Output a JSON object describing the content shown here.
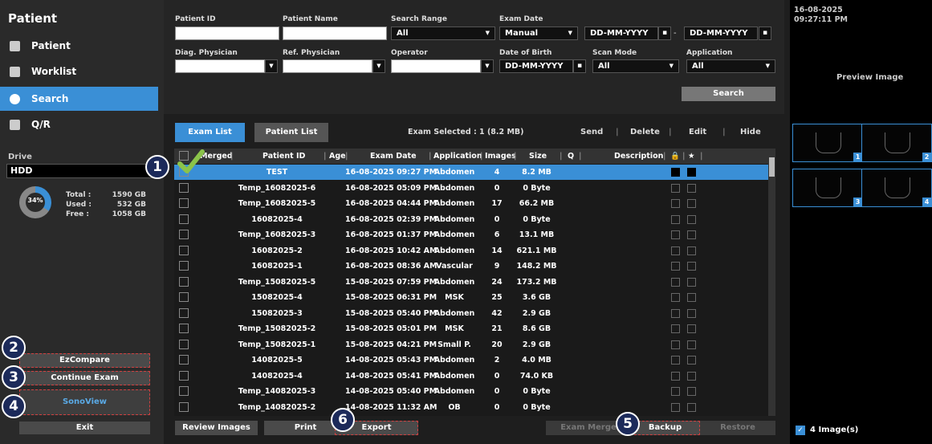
{
  "sidebar": {
    "title": "Patient",
    "nav": [
      {
        "label": "Patient"
      },
      {
        "label": "Worklist"
      },
      {
        "label": "Search"
      },
      {
        "label": "Q/R"
      }
    ],
    "drive_label": "Drive",
    "drive_value": "HDD",
    "usage_percent": 34,
    "usage_label": "34%",
    "total_label": "Total :",
    "total_value": "1590 GB",
    "used_label": "Used :",
    "used_value": "532 GB",
    "free_label": "Free :",
    "free_value": "1058 GB",
    "ezcompare": "EzCompare",
    "continue_exam": "Continue Exam",
    "sonoview": "SonoView",
    "exit": "Exit"
  },
  "badges": [
    "1",
    "2",
    "3",
    "4",
    "5",
    "6"
  ],
  "form": {
    "patient_id_label": "Patient ID",
    "patient_name_label": "Patient Name",
    "search_range_label": "Search Range",
    "search_range_value": "All",
    "exam_date_label": "Exam Date",
    "exam_date_mode": "Manual",
    "date_from": "DD-MM-YYYY",
    "date_to": "DD-MM-YYYY",
    "diag_physician_label": "Diag. Physician",
    "ref_physician_label": "Ref. Physician",
    "operator_label": "Operator",
    "dob_label": "Date of Birth",
    "dob_value": "DD-MM-YYYY",
    "scan_mode_label": "Scan Mode",
    "scan_mode_value": "All",
    "application_label": "Application",
    "application_value": "All",
    "search_button": "Search"
  },
  "toolbar": {
    "exam_list_tab": "Exam List",
    "patient_list_tab": "Patient List",
    "exam_selected": "Exam Selected : 1 (8.2 MB)",
    "send": "Send",
    "delete": "Delete",
    "edit": "Edit",
    "hide": "Hide"
  },
  "table": {
    "headers": {
      "merged": "Merged",
      "patient_id": "Patient ID",
      "age": "Age",
      "exam_date": "Exam Date",
      "application": "Application",
      "images": "Images",
      "size": "Size",
      "q": "Q",
      "description": "Description"
    },
    "rows": [
      {
        "pid": "TEST",
        "date": "16-08-2025 09:27 PM",
        "app": "Abdomen",
        "images": "4",
        "size": "8.2 MB",
        "selected": true
      },
      {
        "pid": "Temp_16082025-6",
        "date": "16-08-2025 05:09 PM",
        "app": "Abdomen",
        "images": "0",
        "size": "0 Byte"
      },
      {
        "pid": "Temp_16082025-5",
        "date": "16-08-2025 04:44 PM",
        "app": "Abdomen",
        "images": "17",
        "size": "66.2 MB"
      },
      {
        "pid": "16082025-4",
        "date": "16-08-2025 02:39 PM",
        "app": "Abdomen",
        "images": "0",
        "size": "0 Byte"
      },
      {
        "pid": "Temp_16082025-3",
        "date": "16-08-2025 01:37 PM",
        "app": "Abdomen",
        "images": "6",
        "size": "13.1 MB"
      },
      {
        "pid": "16082025-2",
        "date": "16-08-2025 10:42 AM",
        "app": "Abdomen",
        "images": "14",
        "size": "621.1 MB"
      },
      {
        "pid": "16082025-1",
        "date": "16-08-2025 08:36 AM",
        "app": "Vascular",
        "images": "9",
        "size": "148.2 MB"
      },
      {
        "pid": "Temp_15082025-5",
        "date": "15-08-2025 07:59 PM",
        "app": "Abdomen",
        "images": "24",
        "size": "173.2 MB"
      },
      {
        "pid": "15082025-4",
        "date": "15-08-2025 06:31 PM",
        "app": "MSK",
        "images": "25",
        "size": "3.6 GB"
      },
      {
        "pid": "15082025-3",
        "date": "15-08-2025 05:40 PM",
        "app": "Abdomen",
        "images": "42",
        "size": "2.9 GB"
      },
      {
        "pid": "Temp_15082025-2",
        "date": "15-08-2025 05:01 PM",
        "app": "MSK",
        "images": "21",
        "size": "8.6 GB"
      },
      {
        "pid": "Temp_15082025-1",
        "date": "15-08-2025 04:21 PM",
        "app": "Small P.",
        "images": "20",
        "size": "2.9 GB"
      },
      {
        "pid": "14082025-5",
        "date": "14-08-2025 05:43 PM",
        "app": "Abdomen",
        "images": "2",
        "size": "4.0 MB"
      },
      {
        "pid": "14082025-4",
        "date": "14-08-2025 05:41 PM",
        "app": "Abdomen",
        "images": "0",
        "size": "74.0 KB"
      },
      {
        "pid": "Temp_14082025-3",
        "date": "14-08-2025 05:40 PM",
        "app": "Abdomen",
        "images": "0",
        "size": "0 Byte"
      },
      {
        "pid": "Temp_14082025-2",
        "date": "14-08-2025 11:32 AM",
        "app": "OB",
        "images": "0",
        "size": "0 Byte"
      }
    ]
  },
  "bottom": {
    "review_images": "Review Images",
    "print": "Print",
    "export": "Export",
    "exam_merge": "Exam Merge",
    "backup": "Backup",
    "restore": "Restore"
  },
  "preview": {
    "date": "16-08-2025",
    "time": "09:27:11 PM",
    "preview_label": "Preview Image",
    "thumb_numbers": [
      "1",
      "2",
      "3",
      "4"
    ],
    "images_checkbox": "4 Image(s)"
  },
  "colors": {
    "accent": "#3a8fd6",
    "annotation_dash": "#d04040",
    "checkmark": "#8bc34a"
  }
}
